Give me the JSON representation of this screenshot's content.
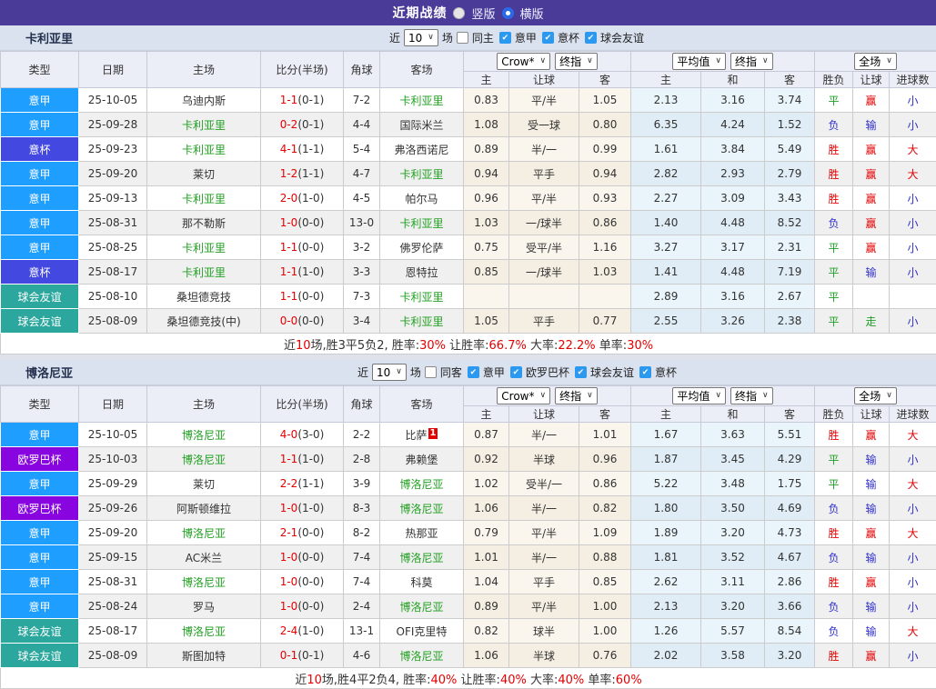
{
  "title_bar": {
    "title": "近期战绩",
    "layout_options": [
      {
        "label": "竖版",
        "selected": false
      },
      {
        "label": "横版",
        "selected": true
      }
    ]
  },
  "colors": {
    "accent_bar": "#4b3b98",
    "type_badges": {
      "意甲": "#1e9fff",
      "意杯": "#4348e0",
      "欧罗巴杯": "#8805e0",
      "球会友谊": "#2ba79e"
    },
    "result_win": "#e50000",
    "result_draw": "#1f9e26",
    "result_lose": "#3030cc",
    "team_highlight": "#22a022",
    "score": "#e50000"
  },
  "table_columns": [
    "类型",
    "日期",
    "主场",
    "比分(半场)",
    "角球",
    "客场",
    "主",
    "让球",
    "客",
    "主",
    "和",
    "客",
    "胜负",
    "让球",
    "进球数"
  ],
  "header_controls": {
    "company": "Crow*",
    "stage": "终指",
    "average": "平均值",
    "avg_stage": "终指",
    "scope": "全场"
  },
  "sections": [
    {
      "team": "卡利亚里",
      "filter": {
        "recent_label": "近",
        "count": "10",
        "games_label": "场",
        "same_label": "同主",
        "same_checked": false,
        "leagues": [
          {
            "label": "意甲",
            "checked": true
          },
          {
            "label": "意杯",
            "checked": true
          },
          {
            "label": "球会友谊",
            "checked": true
          }
        ]
      },
      "rows": [
        {
          "type": "意甲",
          "date": "25-10-05",
          "home": "乌迪内斯",
          "score": "1-1",
          "half": "(0-1)",
          "corner": "7-2",
          "away": "卡利亚里",
          "away_badge": "",
          "odds_home": "0.83",
          "handicap": "平/半",
          "odds_away": "1.05",
          "avg_home": "2.13",
          "avg_draw": "3.16",
          "avg_away": "3.74",
          "r_wdl": "平",
          "r_handicap": "赢",
          "r_goals": "小"
        },
        {
          "type": "意甲",
          "date": "25-09-28",
          "home": "卡利亚里",
          "score": "0-2",
          "half": "(0-1)",
          "corner": "4-4",
          "away": "国际米兰",
          "away_badge": "",
          "odds_home": "1.08",
          "handicap": "受一球",
          "odds_away": "0.80",
          "avg_home": "6.35",
          "avg_draw": "4.24",
          "avg_away": "1.52",
          "r_wdl": "负",
          "r_handicap": "输",
          "r_goals": "小"
        },
        {
          "type": "意杯",
          "date": "25-09-23",
          "home": "卡利亚里",
          "score": "4-1",
          "half": "(1-1)",
          "corner": "5-4",
          "away": "弗洛西诺尼",
          "away_badge": "",
          "odds_home": "0.89",
          "handicap": "半/一",
          "odds_away": "0.99",
          "avg_home": "1.61",
          "avg_draw": "3.84",
          "avg_away": "5.49",
          "r_wdl": "胜",
          "r_handicap": "赢",
          "r_goals": "大"
        },
        {
          "type": "意甲",
          "date": "25-09-20",
          "home": "莱切",
          "score": "1-2",
          "half": "(1-1)",
          "corner": "4-7",
          "away": "卡利亚里",
          "away_badge": "",
          "odds_home": "0.94",
          "handicap": "平手",
          "odds_away": "0.94",
          "avg_home": "2.82",
          "avg_draw": "2.93",
          "avg_away": "2.79",
          "r_wdl": "胜",
          "r_handicap": "赢",
          "r_goals": "大"
        },
        {
          "type": "意甲",
          "date": "25-09-13",
          "home": "卡利亚里",
          "score": "2-0",
          "half": "(1-0)",
          "corner": "4-5",
          "away": "帕尔马",
          "away_badge": "",
          "odds_home": "0.96",
          "handicap": "平/半",
          "odds_away": "0.93",
          "avg_home": "2.27",
          "avg_draw": "3.09",
          "avg_away": "3.43",
          "r_wdl": "胜",
          "r_handicap": "赢",
          "r_goals": "小"
        },
        {
          "type": "意甲",
          "date": "25-08-31",
          "home": "那不勒斯",
          "score": "1-0",
          "half": "(0-0)",
          "corner": "13-0",
          "away": "卡利亚里",
          "away_badge": "",
          "odds_home": "1.03",
          "handicap": "一/球半",
          "odds_away": "0.86",
          "avg_home": "1.40",
          "avg_draw": "4.48",
          "avg_away": "8.52",
          "r_wdl": "负",
          "r_handicap": "赢",
          "r_goals": "小"
        },
        {
          "type": "意甲",
          "date": "25-08-25",
          "home": "卡利亚里",
          "score": "1-1",
          "half": "(0-0)",
          "corner": "3-2",
          "away": "佛罗伦萨",
          "away_badge": "",
          "odds_home": "0.75",
          "handicap": "受平/半",
          "odds_away": "1.16",
          "avg_home": "3.27",
          "avg_draw": "3.17",
          "avg_away": "2.31",
          "r_wdl": "平",
          "r_handicap": "赢",
          "r_goals": "小"
        },
        {
          "type": "意杯",
          "date": "25-08-17",
          "home": "卡利亚里",
          "score": "1-1",
          "half": "(1-0)",
          "corner": "3-3",
          "away": "恩特拉",
          "away_badge": "",
          "odds_home": "0.85",
          "handicap": "一/球半",
          "odds_away": "1.03",
          "avg_home": "1.41",
          "avg_draw": "4.48",
          "avg_away": "7.19",
          "r_wdl": "平",
          "r_handicap": "输",
          "r_goals": "小"
        },
        {
          "type": "球会友谊",
          "date": "25-08-10",
          "home": "桑坦德竞技",
          "score": "1-1",
          "half": "(0-0)",
          "corner": "7-3",
          "away": "卡利亚里",
          "away_badge": "",
          "odds_home": "",
          "handicap": "",
          "odds_away": "",
          "avg_home": "2.89",
          "avg_draw": "3.16",
          "avg_away": "2.67",
          "r_wdl": "平",
          "r_handicap": "",
          "r_goals": ""
        },
        {
          "type": "球会友谊",
          "date": "25-08-09",
          "home": "桑坦德竞技(中)",
          "score": "0-0",
          "half": "(0-0)",
          "corner": "3-4",
          "away": "卡利亚里",
          "away_badge": "",
          "odds_home": "1.05",
          "handicap": "平手",
          "odds_away": "0.77",
          "avg_home": "2.55",
          "avg_draw": "3.26",
          "avg_away": "2.38",
          "r_wdl": "平",
          "r_handicap": "走",
          "r_goals": "小"
        }
      ],
      "summary": {
        "near": "近",
        "games": "10",
        "rest": "场,胜3平5负2, 胜率:",
        "win_rate": "30%",
        "handicap_label": " 让胜率:",
        "handicap_rate": "66.7%",
        "big_label": " 大率:",
        "big_rate": "22.2%",
        "single_label": " 单率:",
        "single_rate": "30%"
      }
    },
    {
      "team": "博洛尼亚",
      "filter": {
        "recent_label": "近",
        "count": "10",
        "games_label": "场",
        "same_label": "同客",
        "same_checked": false,
        "leagues": [
          {
            "label": "意甲",
            "checked": true
          },
          {
            "label": "欧罗巴杯",
            "checked": true
          },
          {
            "label": "球会友谊",
            "checked": true
          },
          {
            "label": "意杯",
            "checked": true
          }
        ]
      },
      "rows": [
        {
          "type": "意甲",
          "date": "25-10-05",
          "home": "博洛尼亚",
          "score": "4-0",
          "half": "(3-0)",
          "corner": "2-2",
          "away": "比萨",
          "away_badge": "1",
          "odds_home": "0.87",
          "handicap": "半/一",
          "odds_away": "1.01",
          "avg_home": "1.67",
          "avg_draw": "3.63",
          "avg_away": "5.51",
          "r_wdl": "胜",
          "r_handicap": "赢",
          "r_goals": "大"
        },
        {
          "type": "欧罗巴杯",
          "date": "25-10-03",
          "home": "博洛尼亚",
          "score": "1-1",
          "half": "(1-0)",
          "corner": "2-8",
          "away": "弗赖堡",
          "away_badge": "",
          "odds_home": "0.92",
          "handicap": "半球",
          "odds_away": "0.96",
          "avg_home": "1.87",
          "avg_draw": "3.45",
          "avg_away": "4.29",
          "r_wdl": "平",
          "r_handicap": "输",
          "r_goals": "小"
        },
        {
          "type": "意甲",
          "date": "25-09-29",
          "home": "莱切",
          "score": "2-2",
          "half": "(1-1)",
          "corner": "3-9",
          "away": "博洛尼亚",
          "away_badge": "",
          "odds_home": "1.02",
          "handicap": "受半/一",
          "odds_away": "0.86",
          "avg_home": "5.22",
          "avg_draw": "3.48",
          "avg_away": "1.75",
          "r_wdl": "平",
          "r_handicap": "输",
          "r_goals": "大"
        },
        {
          "type": "欧罗巴杯",
          "date": "25-09-26",
          "home": "阿斯顿维拉",
          "score": "1-0",
          "half": "(1-0)",
          "corner": "8-3",
          "away": "博洛尼亚",
          "away_badge": "",
          "odds_home": "1.06",
          "handicap": "半/一",
          "odds_away": "0.82",
          "avg_home": "1.80",
          "avg_draw": "3.50",
          "avg_away": "4.69",
          "r_wdl": "负",
          "r_handicap": "输",
          "r_goals": "小"
        },
        {
          "type": "意甲",
          "date": "25-09-20",
          "home": "博洛尼亚",
          "score": "2-1",
          "half": "(0-0)",
          "corner": "8-2",
          "away": "热那亚",
          "away_badge": "",
          "odds_home": "0.79",
          "handicap": "平/半",
          "odds_away": "1.09",
          "avg_home": "1.89",
          "avg_draw": "3.20",
          "avg_away": "4.73",
          "r_wdl": "胜",
          "r_handicap": "赢",
          "r_goals": "大"
        },
        {
          "type": "意甲",
          "date": "25-09-15",
          "home": "AC米兰",
          "score": "1-0",
          "half": "(0-0)",
          "corner": "7-4",
          "away": "博洛尼亚",
          "away_badge": "",
          "odds_home": "1.01",
          "handicap": "半/一",
          "odds_away": "0.88",
          "avg_home": "1.81",
          "avg_draw": "3.52",
          "avg_away": "4.67",
          "r_wdl": "负",
          "r_handicap": "输",
          "r_goals": "小"
        },
        {
          "type": "意甲",
          "date": "25-08-31",
          "home": "博洛尼亚",
          "score": "1-0",
          "half": "(0-0)",
          "corner": "7-4",
          "away": "科莫",
          "away_badge": "",
          "odds_home": "1.04",
          "handicap": "平手",
          "odds_away": "0.85",
          "avg_home": "2.62",
          "avg_draw": "3.11",
          "avg_away": "2.86",
          "r_wdl": "胜",
          "r_handicap": "赢",
          "r_goals": "小"
        },
        {
          "type": "意甲",
          "date": "25-08-24",
          "home": "罗马",
          "score": "1-0",
          "half": "(0-0)",
          "corner": "2-4",
          "away": "博洛尼亚",
          "away_badge": "",
          "odds_home": "0.89",
          "handicap": "平/半",
          "odds_away": "1.00",
          "avg_home": "2.13",
          "avg_draw": "3.20",
          "avg_away": "3.66",
          "r_wdl": "负",
          "r_handicap": "输",
          "r_goals": "小"
        },
        {
          "type": "球会友谊",
          "date": "25-08-17",
          "home": "博洛尼亚",
          "score": "2-4",
          "half": "(1-0)",
          "corner": "13-1",
          "away": "OFI克里特",
          "away_badge": "",
          "odds_home": "0.82",
          "handicap": "球半",
          "odds_away": "1.00",
          "avg_home": "1.26",
          "avg_draw": "5.57",
          "avg_away": "8.54",
          "r_wdl": "负",
          "r_handicap": "输",
          "r_goals": "大"
        },
        {
          "type": "球会友谊",
          "date": "25-08-09",
          "home": "斯图加特",
          "score": "0-1",
          "half": "(0-1)",
          "corner": "4-6",
          "away": "博洛尼亚",
          "away_badge": "",
          "odds_home": "1.06",
          "handicap": "半球",
          "odds_away": "0.76",
          "avg_home": "2.02",
          "avg_draw": "3.58",
          "avg_away": "3.20",
          "r_wdl": "胜",
          "r_handicap": "赢",
          "r_goals": "小"
        }
      ],
      "summary": {
        "near": "近",
        "games": "10",
        "rest": "场,胜4平2负4, 胜率:",
        "win_rate": "40%",
        "handicap_label": " 让胜率:",
        "handicap_rate": "40%",
        "big_label": " 大率:",
        "big_rate": "40%",
        "single_label": " 单率:",
        "single_rate": "60%"
      }
    }
  ]
}
